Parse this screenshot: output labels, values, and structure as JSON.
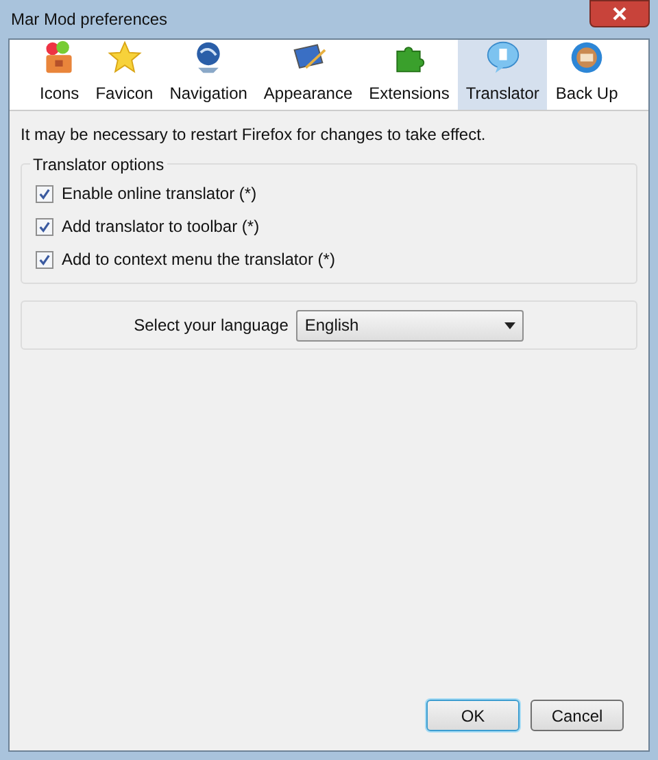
{
  "window": {
    "title": "Mar Mod preferences"
  },
  "tabs": [
    {
      "label": "Icons",
      "selected": false
    },
    {
      "label": "Favicon",
      "selected": false
    },
    {
      "label": "Navigation",
      "selected": false
    },
    {
      "label": "Appearance",
      "selected": false
    },
    {
      "label": "Extensions",
      "selected": false
    },
    {
      "label": "Translator",
      "selected": true
    },
    {
      "label": "Back Up",
      "selected": false
    }
  ],
  "notice": "It may be necessary to restart Firefox for changes to take effect.",
  "translator_options": {
    "legend": "Translator options",
    "options": [
      {
        "label": "Enable online translator (*)",
        "checked": true
      },
      {
        "label": "Add translator to toolbar (*)",
        "checked": true
      },
      {
        "label": "Add to context menu the translator (*)",
        "checked": true
      }
    ]
  },
  "language": {
    "label": "Select your language",
    "value": "English"
  },
  "buttons": [
    {
      "label": "OK",
      "default": true
    },
    {
      "label": "Cancel",
      "default": false
    }
  ]
}
